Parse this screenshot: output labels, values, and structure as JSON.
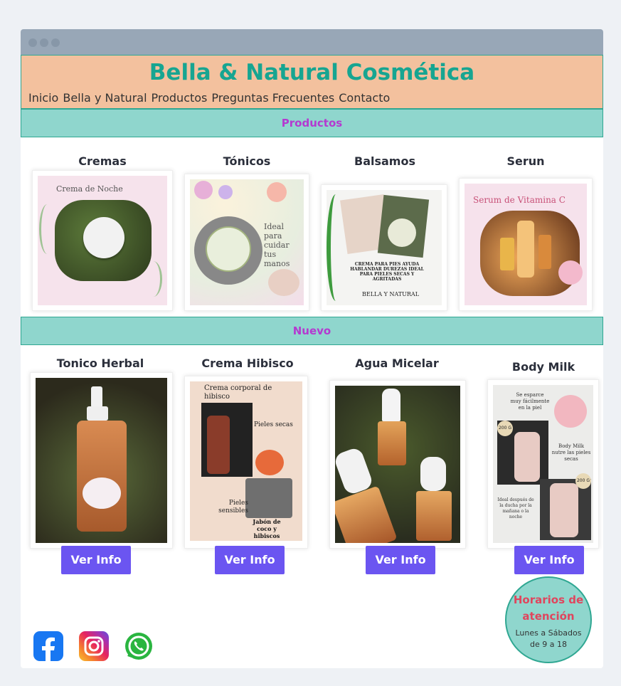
{
  "header": {
    "brand": "Bella & Natural Cosmética",
    "nav": [
      "Inicio",
      "Bella y Natural",
      "Productos",
      "Preguntas Frecuentes",
      "Contacto"
    ]
  },
  "sections": {
    "productos": "Productos",
    "nuevo": "Nuevo"
  },
  "productos": [
    {
      "title": "Cremas",
      "caption": "Crema de Noche"
    },
    {
      "title": "Tónicos",
      "caption": "Ideal para cuidar tus manos"
    },
    {
      "title": "Balsamos",
      "caption": "CREMA PARA PIES AYUDA HABLANDAR DUREZAS IDEAL PARA PIELES SECAS Y AGRITADAS",
      "caption2": "BELLA Y NATURAL"
    },
    {
      "title": "Serun",
      "caption": "Serum de Vitamina C"
    }
  ],
  "nuevo": [
    {
      "title": "Tonico Herbal",
      "button": "Ver Info"
    },
    {
      "title": "Crema Hibisco",
      "button": "Ver Info",
      "caption": "Crema corporal de hibisco",
      "c2": "Pieles secas",
      "c3": "Pieles sensibles",
      "c4": "Jabón de coco y hibiscos"
    },
    {
      "title": "Agua Micelar",
      "button": "Ver Info"
    },
    {
      "title": "Body Milk",
      "button": "Ver Info",
      "c1": "Se esparce muy fácilmente en la piel",
      "c2": "200 G",
      "c3": "Body Milk nutre las pieles secas",
      "c4": "200 G",
      "c5": "Ideal después de la ducha por la mañana o la noche"
    }
  ],
  "hours": {
    "title_1": "Horarios de",
    "title_2": "atención",
    "line_1": "Lunes a Sábados",
    "line_2": "de 9 a 18"
  },
  "social": [
    "facebook-icon",
    "instagram-icon",
    "whatsapp-icon"
  ],
  "colors": {
    "brand": "#17a591",
    "header_bg": "#f3c19e",
    "band_bg": "#8fd6cd",
    "section_title": "#b43ad0",
    "button": "#6b55f1",
    "hours_title": "#e0455d"
  }
}
